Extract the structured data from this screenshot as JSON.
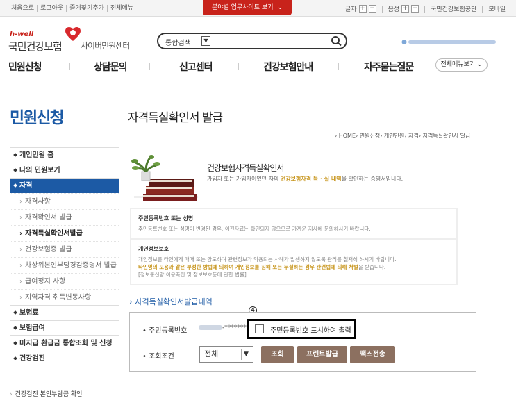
{
  "topbar": {
    "util_links": [
      "처음으로",
      "로그아웃",
      "즐겨찾기추가",
      "전체메뉴"
    ],
    "site_view": "분야별 업무사이트 보기",
    "font_size_label": "글자",
    "font_plus": "+",
    "font_minus": "−",
    "sound_label": "음성",
    "sound_plus": "+",
    "sound_minus": "−",
    "nhis_link": "국민건강보험공단",
    "mobile_link": "모바일"
  },
  "header": {
    "tagline": "h-well",
    "brand": "국민건강보험",
    "sub_brand": "사이버민원센터",
    "search_label": "통합검색"
  },
  "main_menu": [
    "민원신청",
    "상담문의",
    "신고센터",
    "건강보험안내",
    "자주묻는질문"
  ],
  "all_menu_button": "전체메뉴보기",
  "sidebar": {
    "title": "민원신청",
    "items": [
      {
        "label": "개인민원 홈",
        "type": "main"
      },
      {
        "label": "나의 민원보기",
        "type": "main"
      },
      {
        "label": "자격",
        "type": "main",
        "active": true
      },
      {
        "label": "자격사항",
        "type": "sub"
      },
      {
        "label": "자격확인서 발급",
        "type": "sub"
      },
      {
        "label": "자격득실확인서발급",
        "type": "sub",
        "current": true
      },
      {
        "label": "건강보험증 발급",
        "type": "sub"
      },
      {
        "label": "차상위본인부담경감증명서 발급",
        "type": "sub"
      },
      {
        "label": "급여정지 사항",
        "type": "sub"
      },
      {
        "label": "지역자격 취득변동사항",
        "type": "sub"
      },
      {
        "label": "보험료",
        "type": "main"
      },
      {
        "label": "보험급여",
        "type": "main"
      },
      {
        "label": "미지급 환급금 통합조회 및 신청",
        "type": "main"
      },
      {
        "label": "건강검진",
        "type": "main"
      }
    ]
  },
  "content": {
    "page_title": "자격득실확인서 발급",
    "breadcrumb": "› HOME› 민원신청› 개인민원› 자격› 자격득실확인서 발급",
    "cert_title": "건강보험자격득실확인서",
    "cert_desc_pre": "가입자 또는 가입자이었던 자의 ",
    "cert_desc_em": "건강보험자격 득 · 실 내역",
    "cert_desc_post": "을 확인하는 증명서입니다.",
    "box1_title": "주민등록번호 또는 성명",
    "box1_text": "주민등록번호 또는 성명이 변경된 경우, 이전자료는 확인되지 않으므로 가까운 지사에 문의하시기 바랍니다.",
    "box2_title": "개인정보보호",
    "box2_text1": "개인정보를 타인에게 매매 또는 양도하여 관련정보가 악용되는 사례가 발생하지 않도록 관리를 철저히 하시기 바랍니다.",
    "box2_text2": "타인명의 도용과 같은 부정한 방법에 의하여 개인정보를 침해 또는 누설하는 경우 관련법에 의해 처벌",
    "box2_text2_post": "을 받습니다.",
    "box2_text3": "[정보통신망 이용촉진 및 정보보호등에 관한 법률]",
    "section_title": "자격득실확인서발급내역",
    "annotation": "④"
  },
  "form": {
    "rrn_label": "주민등록번호",
    "rrn_mask": "-*******",
    "show_rrn_label": "주민등록번호 표시하여 출력",
    "cond_label": "조회조건",
    "cond_value": "전체",
    "btn_search": "조회",
    "btn_print": "프린트발급",
    "btn_fax": "팩스전송"
  },
  "sidebar_bottom_cut": "건강검진 본인부담금 확인",
  "colors": {
    "brand_red": "#c8231b",
    "brand_blue": "#1c5aa5",
    "button_brown": "#8c7060"
  }
}
